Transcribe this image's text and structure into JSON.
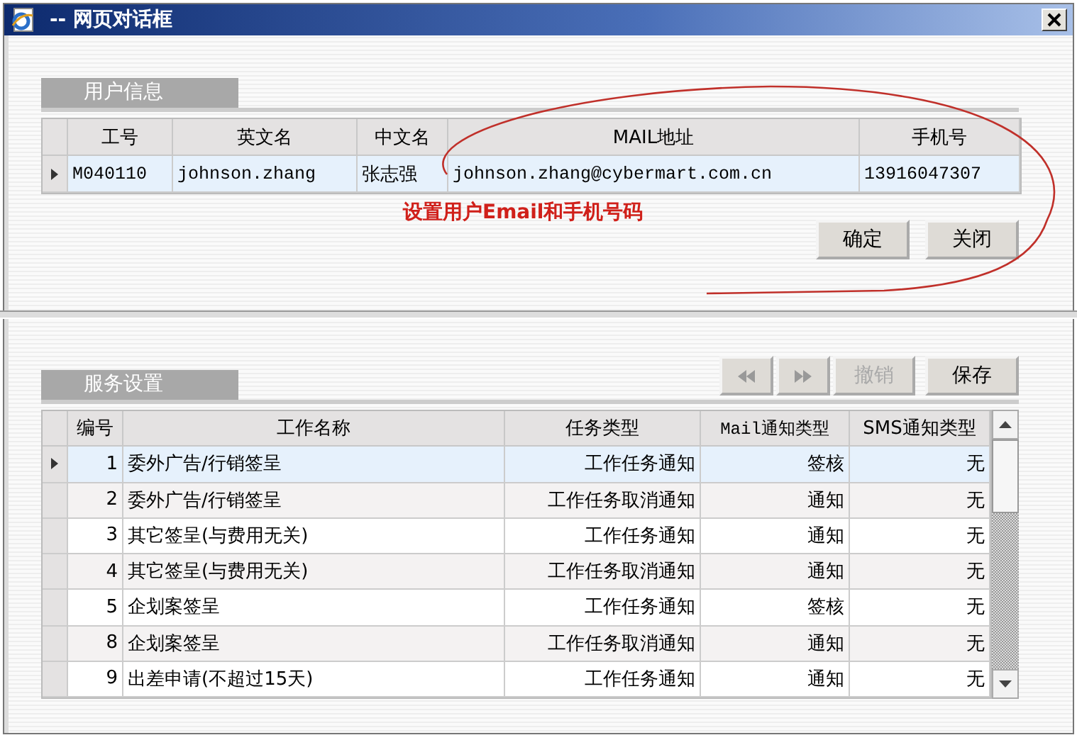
{
  "window": {
    "title": "-- 网页对话框"
  },
  "user_panel": {
    "tab": "用户信息",
    "columns": [
      "工号",
      "英文名",
      "中文名",
      "MAIL地址",
      "手机号"
    ],
    "rows": [
      {
        "selected": true,
        "cells": [
          "M040110",
          "johnson.zhang",
          "张志强",
          "johnson.zhang@cybermart.com.cn",
          "13916047307"
        ]
      }
    ],
    "annotation": "设置用户Email和手机号码",
    "buttons": [
      "确定",
      "关闭"
    ]
  },
  "service_panel": {
    "tab": "服务设置",
    "toolbar": [
      {
        "kind": "first",
        "disabled": true
      },
      {
        "kind": "last",
        "disabled": true
      },
      {
        "kind": "text",
        "label": "撤销",
        "disabled": true
      },
      {
        "kind": "text",
        "label": "保存",
        "disabled": false
      }
    ],
    "columns": [
      "编号",
      "工作名称",
      "任务类型",
      "Mail通知类型",
      "SMS通知类型"
    ],
    "rows": [
      {
        "selected": true,
        "cells": [
          "1",
          "委外广告/行销签呈",
          "工作任务通知",
          "签核",
          "无"
        ]
      },
      {
        "selected": false,
        "cells": [
          "2",
          "委外广告/行销签呈",
          "工作任务取消通知",
          "通知",
          "无"
        ]
      },
      {
        "selected": false,
        "cells": [
          "3",
          "其它签呈(与费用无关)",
          "工作任务通知",
          "通知",
          "无"
        ]
      },
      {
        "selected": false,
        "cells": [
          "4",
          "其它签呈(与费用无关)",
          "工作任务取消通知",
          "通知",
          "无"
        ]
      },
      {
        "selected": false,
        "cells": [
          "5",
          "企划案签呈",
          "工作任务通知",
          "签核",
          "无"
        ]
      },
      {
        "selected": false,
        "cells": [
          "8",
          "企划案签呈",
          "工作任务取消通知",
          "通知",
          "无"
        ]
      },
      {
        "selected": false,
        "cells": [
          "9",
          "出差申请(不超过15天)",
          "工作任务通知",
          "通知",
          "无"
        ]
      }
    ]
  }
}
